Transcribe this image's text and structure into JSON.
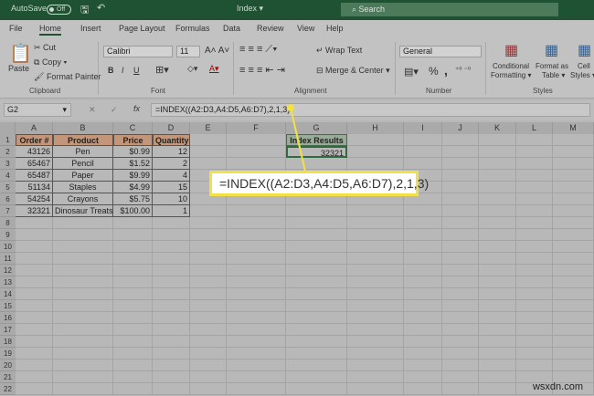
{
  "titlebar": {
    "autosave": "AutoSave",
    "toggle": "Off",
    "filename": "Index ▾",
    "search": "Search"
  },
  "tabs": [
    "File",
    "Home",
    "Insert",
    "Page Layout",
    "Formulas",
    "Data",
    "Review",
    "View",
    "Help"
  ],
  "ribbon": {
    "paste": "Paste",
    "cut": "Cut",
    "copy": "Copy",
    "format_painter": "Format Painter",
    "clipboard": "Clipboard",
    "font_name": "Calibri",
    "font_size": "11",
    "bold": "B",
    "italic": "I",
    "underline": "U",
    "font": "Font",
    "wrap_text": "Wrap Text",
    "merge_center": "Merge & Center",
    "alignment": "Alignment",
    "number_format": "General",
    "percent": "%",
    "comma": ",",
    "number": "Number",
    "conditional": "Conditional",
    "formatting": "Formatting ▾",
    "format_as": "Format as",
    "table": "Table ▾",
    "cell": "Cell",
    "styles_btn": "Styles ▾",
    "styles": "Styles"
  },
  "formula_bar": {
    "name_box": "G2",
    "fx": "fx",
    "formula": "=INDEX((A2:D3,A4:D5,A6:D7),2,1,3)"
  },
  "columns": [
    "A",
    "B",
    "C",
    "D",
    "E",
    "F",
    "G",
    "H",
    "I",
    "J",
    "K",
    "L",
    "M"
  ],
  "table": {
    "headers": [
      "Order #",
      "Product",
      "Price",
      "Quantity"
    ],
    "rows": [
      [
        "43126",
        "Pen",
        "$0.99",
        "12"
      ],
      [
        "65467",
        "Pencil",
        "$1.52",
        "2"
      ],
      [
        "65487",
        "Paper",
        "$9.99",
        "4"
      ],
      [
        "51134",
        "Staples",
        "$4.99",
        "15"
      ],
      [
        "54254",
        "Crayons",
        "$5.75",
        "10"
      ],
      [
        "32321",
        "Dinosaur Treats",
        "$100.00",
        "1"
      ]
    ]
  },
  "result": {
    "header": "Index Results",
    "value": "32321"
  },
  "callout": "=INDEX((A2:D3,A4:D5,A6:D7),2,1,3)",
  "watermark": "wsxdn.com",
  "colors": {
    "title_green": "#1f5232",
    "header_orange": "#c3967a",
    "callout_yellow": "#f2e144"
  }
}
